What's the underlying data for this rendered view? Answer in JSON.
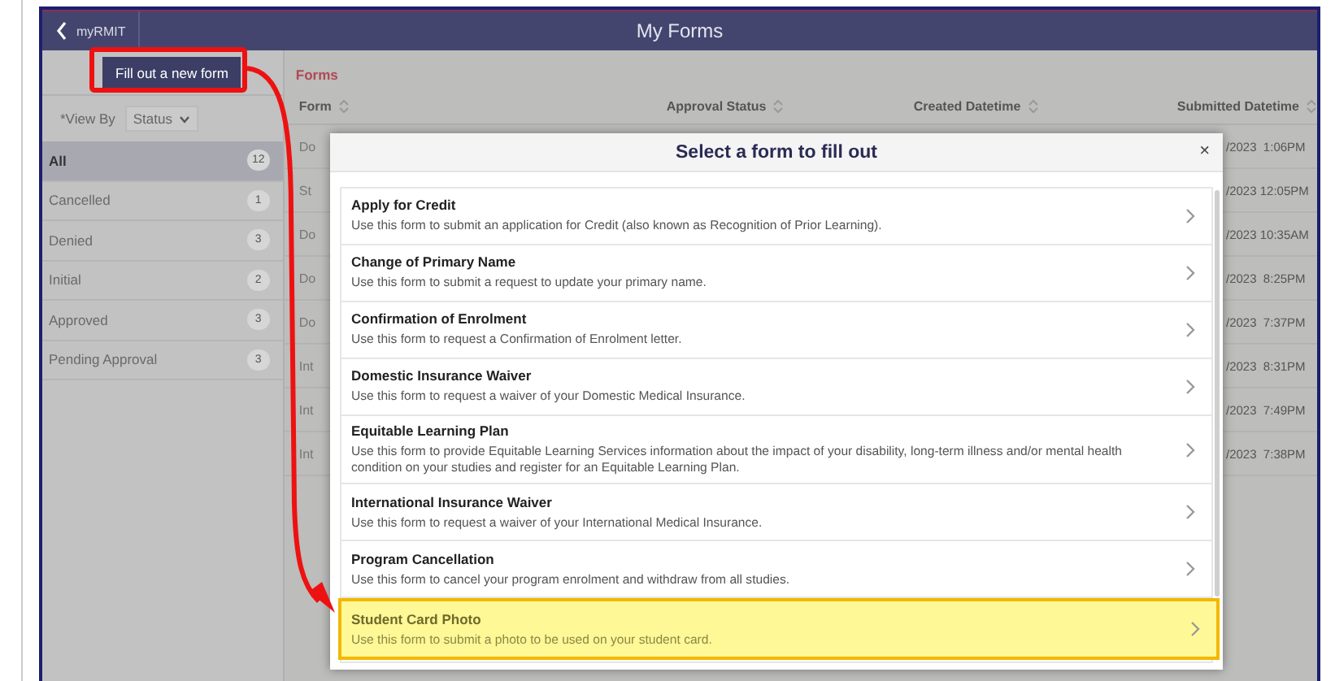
{
  "app_bar": {
    "back_label": "myRMIT",
    "title": "My Forms"
  },
  "sidebar": {
    "new_form_button": "Fill out a new form",
    "view_by": {
      "label": "*View By",
      "value": "Status"
    },
    "statuses": [
      {
        "label": "All",
        "count": "12",
        "selected": true
      },
      {
        "label": "Cancelled",
        "count": "1",
        "selected": false
      },
      {
        "label": "Denied",
        "count": "3",
        "selected": false
      },
      {
        "label": "Initial",
        "count": "2",
        "selected": false
      },
      {
        "label": "Approved",
        "count": "3",
        "selected": false
      },
      {
        "label": "Pending Approval",
        "count": "3",
        "selected": false
      }
    ]
  },
  "main": {
    "heading": "Forms",
    "table": {
      "columns": [
        "Form",
        "Approval Status",
        "Created Datetime",
        "Submitted Datetime"
      ],
      "rows": [
        {
          "form": "Do",
          "submitted": "/2023  1:06PM"
        },
        {
          "form": "St",
          "submitted": "/2023 12:05PM"
        },
        {
          "form": "Do",
          "submitted": "/2023 10:35AM"
        },
        {
          "form": "Do",
          "submitted": "/2023  8:25PM"
        },
        {
          "form": "Do",
          "submitted": "/2023  7:37PM"
        },
        {
          "form": "Int",
          "submitted": "/2023  8:31PM"
        },
        {
          "form": "Int",
          "submitted": "/2023  7:49PM"
        },
        {
          "form": "Int",
          "submitted": "/2023  7:38PM"
        }
      ]
    }
  },
  "dialog": {
    "title": "Select a form to fill out",
    "close": "×",
    "forms": [
      {
        "title": "Apply for Credit",
        "description": "Use this form to submit an application for Credit (also known as Recognition of Prior Learning).",
        "highlighted": false
      },
      {
        "title": "Change of Primary Name",
        "description": "Use this form to submit a request to update your primary name.",
        "highlighted": false
      },
      {
        "title": "Confirmation of Enrolment",
        "description": "Use this form to request a Confirmation of Enrolment letter.",
        "highlighted": false
      },
      {
        "title": "Domestic Insurance Waiver",
        "description": "Use this form to request a waiver of your Domestic Medical Insurance.",
        "highlighted": false
      },
      {
        "title": "Equitable Learning Plan",
        "description": "Use this form to provide Equitable Learning Services information about the impact of your disability, long-term illness and/or mental health condition on your studies and register for an Equitable Learning Plan.",
        "highlighted": false
      },
      {
        "title": "International Insurance Waiver",
        "description": "Use this form to request a waiver of your International Medical Insurance.",
        "highlighted": false
      },
      {
        "title": "Program Cancellation",
        "description": "Use this form to cancel your program enrolment and withdraw from all studies.",
        "highlighted": false
      },
      {
        "title": "Student Card Photo",
        "description": "Use this form to submit a photo to be used on your student card.",
        "highlighted": true
      }
    ]
  }
}
